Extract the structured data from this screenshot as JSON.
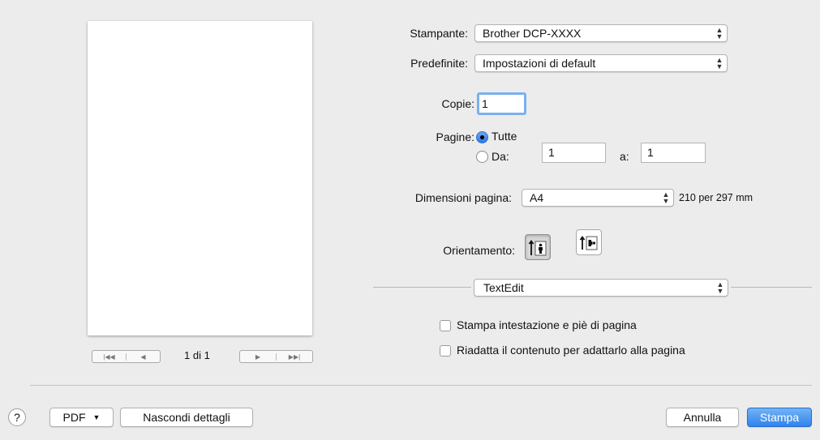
{
  "preview": {
    "page_indicator": "1 di 1"
  },
  "printer": {
    "label": "Stampante:",
    "value": "Brother DCP-XXXX"
  },
  "presets": {
    "label": "Predefinite:",
    "value": "Impostazioni di default"
  },
  "copies": {
    "label": "Copie:",
    "value": "1"
  },
  "pages": {
    "label": "Pagine:",
    "all_label": "Tutte",
    "from_label": "Da:",
    "from_value": "1",
    "to_label": "a:",
    "to_value": "1",
    "selected": "all"
  },
  "paper_size": {
    "label": "Dimensioni pagina:",
    "value": "A4",
    "dimensions": "210 per 297 mm"
  },
  "orientation": {
    "label": "Orientamento:",
    "selected": "portrait"
  },
  "section_menu": {
    "value": "TextEdit"
  },
  "options": {
    "header_footer": {
      "label": "Stampa intestazione e piè di pagina",
      "checked": false
    },
    "rewrap": {
      "label": "Riadatta il contenuto per adattarlo alla pagina",
      "checked": false
    }
  },
  "footer": {
    "help": "?",
    "pdf": "PDF",
    "hide_details": "Nascondi dettagli",
    "cancel": "Annulla",
    "print": "Stampa"
  },
  "colors": {
    "accent": "#2f83ee",
    "dialog_bg": "#ececec"
  }
}
